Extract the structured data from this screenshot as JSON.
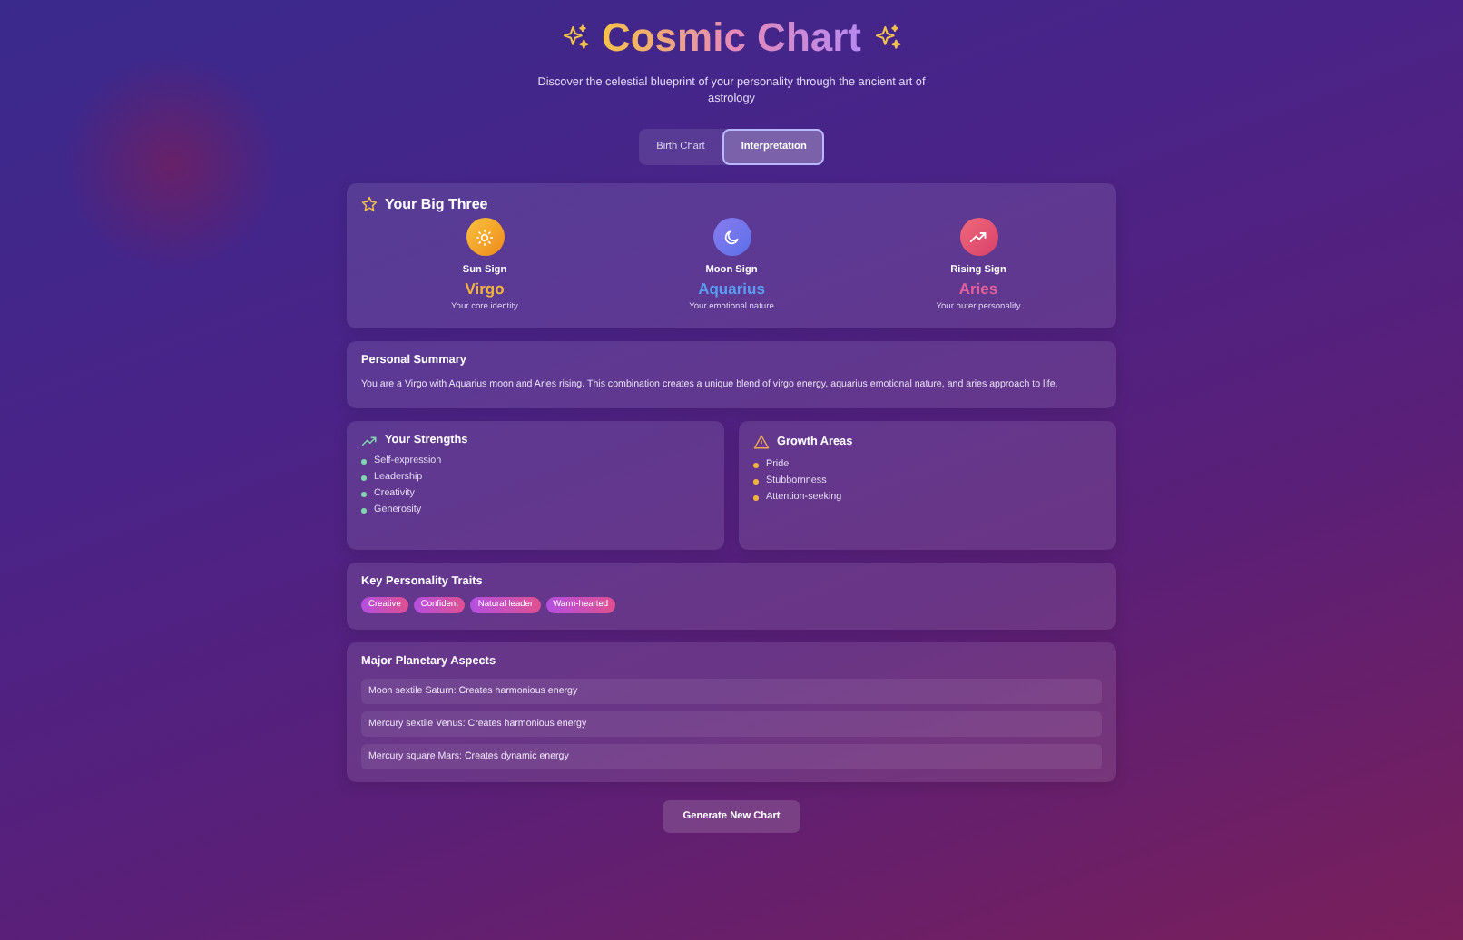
{
  "header": {
    "title": "Cosmic Chart",
    "subtitle": "Discover the celestial blueprint of your personality through the ancient art of astrology"
  },
  "tabs": [
    {
      "label": "Birth Chart",
      "selected": false
    },
    {
      "label": "Interpretation",
      "selected": true
    }
  ],
  "big_three": {
    "title": "Your Big Three",
    "signs": [
      {
        "kind": "sun",
        "label": "Sun Sign",
        "sign": "Virgo",
        "description": "Your core identity",
        "color": "#f2b33d"
      },
      {
        "kind": "moon",
        "label": "Moon Sign",
        "sign": "Aquarius",
        "description": "Your emotional nature",
        "color": "#5b9cf0"
      },
      {
        "kind": "rising",
        "label": "Rising Sign",
        "sign": "Aries",
        "description": "Your outer personality",
        "color": "#e0609a"
      }
    ]
  },
  "summary": {
    "title": "Personal Summary",
    "text": "You are a Virgo with Aquarius moon and Aries rising. This combination creates a unique blend of virgo energy, aquarius emotional nature, and aries approach to life."
  },
  "strengths": {
    "title": "Your Strengths",
    "items": [
      "Self-expression",
      "Leadership",
      "Creativity",
      "Generosity"
    ]
  },
  "growth_areas": {
    "title": "Growth Areas",
    "items": [
      "Pride",
      "Stubbornness",
      "Attention-seeking"
    ]
  },
  "traits": {
    "title": "Key Personality Traits",
    "tags": [
      "Creative",
      "Confident",
      "Natural leader",
      "Warm-hearted"
    ]
  },
  "aspects": {
    "title": "Major Planetary Aspects",
    "items": [
      "Moon sextile Saturn: Creates harmonious energy",
      "Mercury sextile Venus: Creates harmonious energy",
      "Mercury square Mars: Creates dynamic energy"
    ]
  },
  "generate_button": "Generate New Chart"
}
